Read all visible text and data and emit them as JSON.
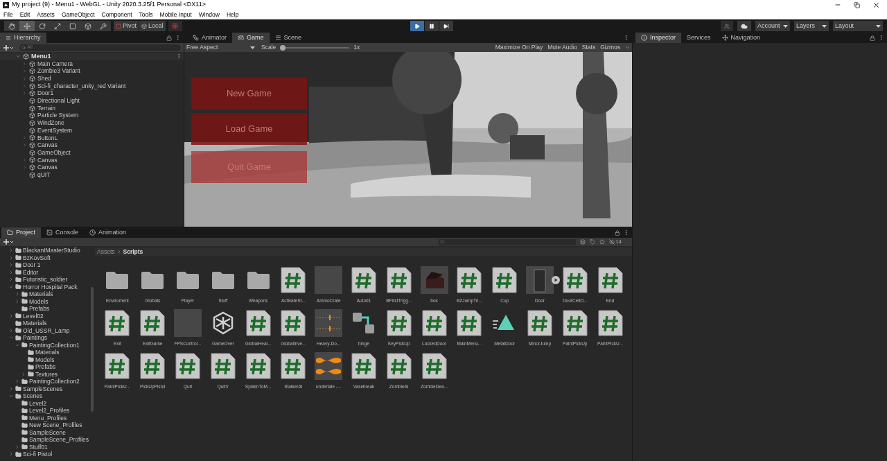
{
  "window": {
    "title": "My project (9) - Menu1 - WebGL - Unity 2020.3.25f1 Personal <DX11>"
  },
  "menu": [
    "File",
    "Edit",
    "Assets",
    "GameObject",
    "Component",
    "Tools",
    "Mobile Input",
    "Window",
    "Help"
  ],
  "toolbar": {
    "tools": [
      {
        "kind": "hand",
        "selected": false
      },
      {
        "kind": "move",
        "selected": true
      },
      {
        "kind": "rotate",
        "selected": false
      },
      {
        "kind": "scale",
        "selected": false
      },
      {
        "kind": "rect",
        "selected": false
      },
      {
        "kind": "transform",
        "selected": false
      },
      {
        "kind": "custom",
        "selected": false
      }
    ],
    "pivot": "Pivot",
    "local": "Local",
    "account": "Account",
    "layers": "Layers",
    "layout": "Layout"
  },
  "playback": {
    "playing": true
  },
  "hierarchy": {
    "title": "Hierarchy",
    "search_placeholder": "All",
    "scene": "Menu1",
    "items": [
      {
        "name": "Main Camera",
        "has_children": true
      },
      {
        "name": "Zombie3 Variant",
        "has_children": true
      },
      {
        "name": "Shed",
        "has_children": true
      },
      {
        "name": "Sci-fi_character_unity_red Variant",
        "has_children": true
      },
      {
        "name": "Door1",
        "has_children": true
      },
      {
        "name": "Directional Light",
        "has_children": false
      },
      {
        "name": "Terrain",
        "has_children": false
      },
      {
        "name": "Particle System",
        "has_children": false
      },
      {
        "name": "WindZone",
        "has_children": false
      },
      {
        "name": "EventSystem",
        "has_children": false
      },
      {
        "name": "ButtonL",
        "has_children": true
      },
      {
        "name": "Canvas",
        "has_children": true
      },
      {
        "name": "GameObject",
        "has_children": false
      },
      {
        "name": "Canvas",
        "has_children": true
      },
      {
        "name": "Canvas",
        "has_children": true
      },
      {
        "name": "qUIT",
        "has_children": false
      }
    ]
  },
  "center_tabs": [
    {
      "label": "Animator",
      "kind": "animator",
      "selected": false
    },
    {
      "label": "Game",
      "kind": "game",
      "selected": true
    },
    {
      "label": "Scene",
      "kind": "scene",
      "selected": false
    }
  ],
  "game": {
    "aspect": "Free Aspect",
    "scale_label": "Scale",
    "scale": {
      "level": 0.0
    },
    "scale_value": "1x",
    "options": [
      "Maximize On Play",
      "Mute Audio",
      "Stats",
      "Gizmos"
    ],
    "menu_buttons": [
      "New Game",
      "Load Game",
      "Quit Game"
    ]
  },
  "right_tabs": [
    {
      "label": "Inspector",
      "kind": "info",
      "selected": true
    },
    {
      "label": "Services",
      "kind": "none",
      "selected": false
    },
    {
      "label": "Navigation",
      "kind": "nav",
      "selected": false
    }
  ],
  "bottom_tabs": [
    {
      "label": "Project",
      "kind": "folder",
      "selected": true
    },
    {
      "label": "Console",
      "kind": "console",
      "selected": false
    },
    {
      "label": "Animation",
      "kind": "clock",
      "selected": false
    }
  ],
  "project": {
    "hidden_count": "14",
    "breadcrumb": [
      "Assets",
      "Scripts"
    ],
    "tree": [
      {
        "name": "BlackantMasterStudio",
        "has_children": true,
        "expanded": false
      },
      {
        "name": "BzKovSoft",
        "has_children": true,
        "expanded": false
      },
      {
        "name": "Door 1",
        "has_children": true,
        "expanded": false
      },
      {
        "name": "Editor",
        "has_children": true,
        "expanded": false
      },
      {
        "name": "Futuristic_soldier",
        "has_children": true,
        "expanded": false
      },
      {
        "name": "Horror Hospital Pack",
        "has_children": true,
        "expanded": true,
        "children": [
          {
            "name": "Materials",
            "has_children": true,
            "expanded": false
          },
          {
            "name": "Models",
            "has_children": true,
            "expanded": false
          },
          {
            "name": "Prefabs",
            "has_children": false,
            "expanded": false
          }
        ]
      },
      {
        "name": "Level02",
        "has_children": true,
        "expanded": false
      },
      {
        "name": "Materials",
        "has_children": false,
        "expanded": false
      },
      {
        "name": "Old_USSR_Lamp",
        "has_children": true,
        "expanded": false
      },
      {
        "name": "Paintings",
        "has_children": true,
        "expanded": true,
        "children": [
          {
            "name": "PaintingCollection1",
            "has_children": true,
            "expanded": true,
            "children": [
              {
                "name": "Materials",
                "has_children": false,
                "expanded": false
              },
              {
                "name": "Models",
                "has_children": false,
                "expanded": false
              },
              {
                "name": "Prefabs",
                "has_children": false,
                "expanded": false
              },
              {
                "name": "Textures",
                "has_children": true,
                "expanded": false
              }
            ]
          },
          {
            "name": "PaintingCollection2",
            "has_children": true,
            "expanded": false
          }
        ]
      },
      {
        "name": "SampleScenes",
        "has_children": true,
        "expanded": false
      },
      {
        "name": "Scenes",
        "has_children": true,
        "expanded": true,
        "children": [
          {
            "name": "Level2",
            "has_children": false,
            "expanded": false
          },
          {
            "name": "Level2_Profiles",
            "has_children": false,
            "expanded": false
          },
          {
            "name": "Menu_Profiles",
            "has_children": false,
            "expanded": false
          },
          {
            "name": "New Scene_Profiles",
            "has_children": false,
            "expanded": false
          },
          {
            "name": "SampleScene",
            "has_children": false,
            "expanded": false
          },
          {
            "name": "SampleScene_Profiles",
            "has_children": false,
            "expanded": false
          },
          {
            "name": "Stuff01",
            "has_children": true,
            "expanded": false
          }
        ]
      },
      {
        "name": "Sci-fi Pistol",
        "has_children": true,
        "expanded": false
      }
    ],
    "assets": [
      {
        "name": "Enviroment",
        "kind": "folder"
      },
      {
        "name": "Globals",
        "kind": "folder"
      },
      {
        "name": "Player",
        "kind": "folder"
      },
      {
        "name": "Stuff",
        "kind": "folder"
      },
      {
        "name": "Weapons",
        "kind": "folder"
      },
      {
        "name": "ActivateSt...",
        "kind": "script"
      },
      {
        "name": "AmmoCrate",
        "kind": "blank"
      },
      {
        "name": "Auto01",
        "kind": "script"
      },
      {
        "name": "BFirstTrigg...",
        "kind": "script"
      },
      {
        "name": "box",
        "kind": "box"
      },
      {
        "name": "BZJumpTri...",
        "kind": "script"
      },
      {
        "name": "Cup",
        "kind": "script"
      },
      {
        "name": "Door",
        "kind": "door"
      },
      {
        "name": "DoorCellO...",
        "kind": "script"
      },
      {
        "name": "End",
        "kind": "script"
      },
      {
        "name": "Exit",
        "kind": "script"
      },
      {
        "name": "ExitGame",
        "kind": "script"
      },
      {
        "name": "FPSControl...",
        "kind": "blank"
      },
      {
        "name": "GameOver",
        "kind": "unity"
      },
      {
        "name": "GlobalHeal...",
        "kind": "script"
      },
      {
        "name": "GlobalInve...",
        "kind": "script"
      },
      {
        "name": "Heavy-Do...",
        "kind": "audio"
      },
      {
        "name": "hinge",
        "kind": "hinge"
      },
      {
        "name": "KeyPickUp",
        "kind": "script"
      },
      {
        "name": "LockedDoor",
        "kind": "script"
      },
      {
        "name": "MainMenu...",
        "kind": "script"
      },
      {
        "name": "MetalDoor",
        "kind": "metal"
      },
      {
        "name": "MinorJump",
        "kind": "script"
      },
      {
        "name": "PaintPickUp",
        "kind": "script"
      },
      {
        "name": "PaintPickU...",
        "kind": "script"
      },
      {
        "name": "PaintPickU...",
        "kind": "script"
      },
      {
        "name": "PickUpPistol",
        "kind": "script"
      },
      {
        "name": "Quit",
        "kind": "script"
      },
      {
        "name": "QuitV",
        "kind": "script"
      },
      {
        "name": "SplashToM...",
        "kind": "script"
      },
      {
        "name": "StalkerAI",
        "kind": "script"
      },
      {
        "name": "undertale -...",
        "kind": "wave"
      },
      {
        "name": "Vasebreak",
        "kind": "script"
      },
      {
        "name": "ZombieAI",
        "kind": "script"
      },
      {
        "name": "ZombieDea...",
        "kind": "script"
      }
    ]
  }
}
